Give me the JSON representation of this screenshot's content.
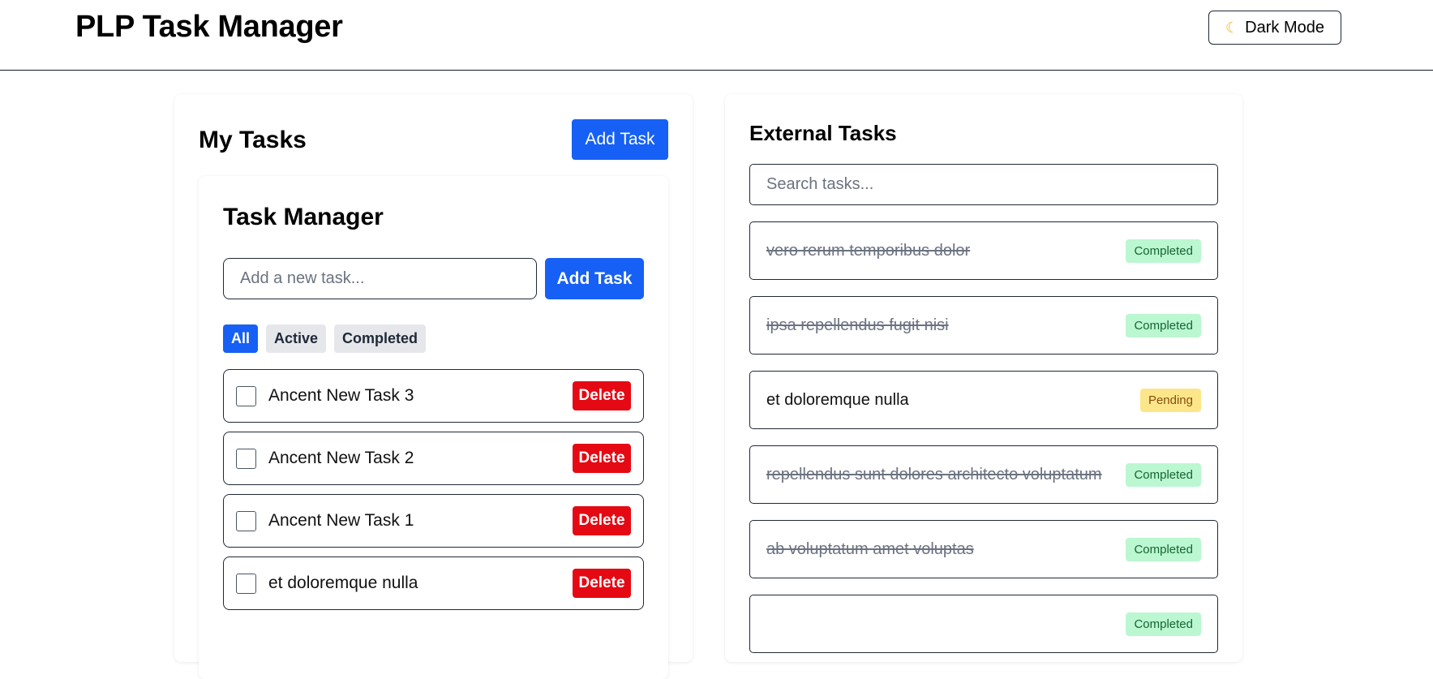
{
  "header": {
    "title": "PLP Task Manager",
    "dark_mode_label": "Dark Mode",
    "dark_mode_icon": "moon-icon"
  },
  "my_tasks": {
    "title": "My Tasks",
    "add_button": "Add Task",
    "task_manager": {
      "title": "Task Manager",
      "input_placeholder": "Add a new task...",
      "add_button": "Add Task",
      "filters": [
        {
          "label": "All",
          "active": true
        },
        {
          "label": "Active",
          "active": false
        },
        {
          "label": "Completed",
          "active": false
        }
      ],
      "tasks": [
        {
          "text": "Ancent New Task 3",
          "delete_label": "Delete"
        },
        {
          "text": "Ancent New Task 2",
          "delete_label": "Delete"
        },
        {
          "text": "Ancent New Task 1",
          "delete_label": "Delete"
        },
        {
          "text": "et doloremque nulla",
          "delete_label": "Delete"
        }
      ]
    }
  },
  "external_tasks": {
    "title": "External Tasks",
    "search_placeholder": "Search tasks...",
    "items": [
      {
        "text": "vero rerum temporibus dolor",
        "status": "Completed",
        "done": true
      },
      {
        "text": "ipsa repellendus fugit nisi",
        "status": "Completed",
        "done": true
      },
      {
        "text": "et doloremque nulla",
        "status": "Pending",
        "done": false
      },
      {
        "text": "repellendus sunt dolores architecto voluptatum",
        "status": "Completed",
        "done": true
      },
      {
        "text": "ab voluptatum amet voluptas",
        "status": "Completed",
        "done": true
      },
      {
        "text": "",
        "status": "Completed",
        "done": true
      }
    ]
  },
  "colors": {
    "primary": "#1660f5",
    "danger": "#e50914",
    "completed_badge_bg": "#bbf7d0",
    "pending_badge_bg": "#fde68a"
  }
}
